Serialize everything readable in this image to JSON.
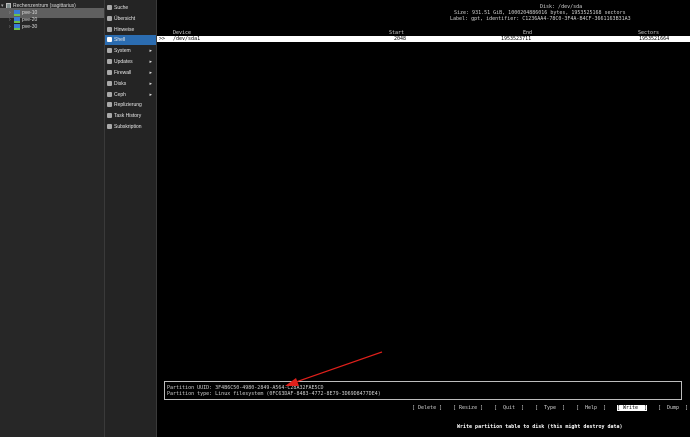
{
  "tree": {
    "datacenter": "Rechenzentrum (sagittarius)",
    "nodes": [
      "pve-10",
      "pve-20",
      "pve-30"
    ]
  },
  "menu": {
    "items": [
      {
        "label": "Suche",
        "icon": "search-icon",
        "submenu": false
      },
      {
        "label": "Übersicht",
        "icon": "summary-icon",
        "submenu": false
      },
      {
        "label": "Hinweise",
        "icon": "notes-icon",
        "submenu": false
      },
      {
        "label": "Shell",
        "icon": "terminal-icon",
        "submenu": false,
        "active": true
      },
      {
        "label": "System",
        "icon": "gear-icon",
        "submenu": true
      },
      {
        "label": "Updates",
        "icon": "refresh-icon",
        "submenu": true
      },
      {
        "label": "Firewall",
        "icon": "firewall-icon",
        "submenu": true
      },
      {
        "label": "Disks",
        "icon": "disk-icon",
        "submenu": true
      },
      {
        "label": "Ceph",
        "icon": "ceph-icon",
        "submenu": true
      },
      {
        "label": "Replizierung",
        "icon": "replication-icon",
        "submenu": false
      },
      {
        "label": "Task History",
        "icon": "list-icon",
        "submenu": false
      },
      {
        "label": "Subskription",
        "icon": "support-icon",
        "submenu": false
      }
    ]
  },
  "terminal": {
    "disk_title": "Disk: /dev/sda",
    "disk_size": "Size: 931.51 GiB, 1000204886016 bytes, 1953525168 sectors",
    "disk_label": "Label: gpt, identifier: C1236AA4-78C0-3F4A-B4CF-3661163B31A3",
    "columns": {
      "device": "Device",
      "start": "Start",
      "end": "End",
      "sectors": "Sectors"
    },
    "row": {
      "marker": ">>",
      "device": "/dev/sda1",
      "start": "2048",
      "end": "1953523711",
      "sectors": "1953521664"
    },
    "partition_uuid": "Partition UUID: 3F4B6C50-4980-2849-A564-C28A32FAE5CD",
    "partition_type": "Partition type: Linux filesystem (0FC63DAF-8483-4772-8E79-3D69D8477DE4)",
    "commands": [
      "[ Delete ]",
      "[ Resize ]",
      "[  Quit  ]",
      "[  Type  ]",
      "[  Help  ]",
      "[ Write  ]",
      "[  Dump  ]"
    ],
    "selected_command": "[ Write  ]",
    "hint": "Write partition table to disk (this might destroy data)"
  },
  "annotation_color": "#e0201b"
}
